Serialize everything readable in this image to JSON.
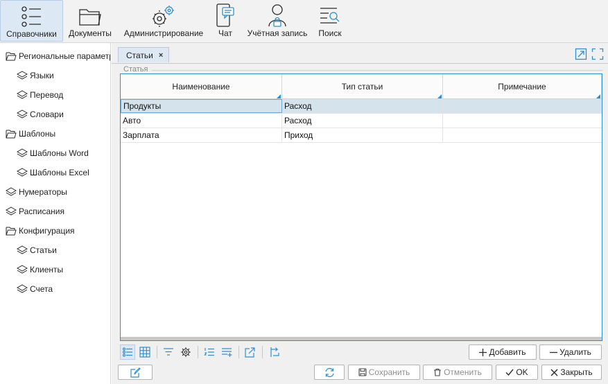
{
  "toolbar": {
    "items": [
      {
        "label": "Справочники",
        "icon": "list-bullets-icon",
        "active": true
      },
      {
        "label": "Документы",
        "icon": "folder-icon"
      },
      {
        "label": "Администрирование",
        "icon": "gears-icon"
      },
      {
        "label": "Чат",
        "icon": "chat-phone-icon"
      },
      {
        "label": "Учётная запись",
        "icon": "user-lock-icon"
      },
      {
        "label": "Поиск",
        "icon": "search-list-icon"
      }
    ]
  },
  "sidebar": {
    "items": [
      {
        "label": "Региональные параметры",
        "icon": "folder-open-icon",
        "level": 0
      },
      {
        "label": "Языки",
        "icon": "layers-icon",
        "level": 1
      },
      {
        "label": "Перевод",
        "icon": "layers-icon",
        "level": 1
      },
      {
        "label": "Словари",
        "icon": "layers-icon",
        "level": 1
      },
      {
        "label": "Шаблоны",
        "icon": "folder-open-icon",
        "level": 0
      },
      {
        "label": "Шаблоны Word",
        "icon": "layers-icon",
        "level": 1
      },
      {
        "label": "Шаблоны Excel",
        "icon": "layers-icon",
        "level": 1
      },
      {
        "label": "Нумераторы",
        "icon": "layers-icon",
        "level": 0
      },
      {
        "label": "Расписания",
        "icon": "layers-icon",
        "level": 0
      },
      {
        "label": "Конфигурация",
        "icon": "folder-open-icon",
        "level": 0
      },
      {
        "label": "Статьи",
        "icon": "layers-icon",
        "level": 1
      },
      {
        "label": "Клиенты",
        "icon": "layers-icon",
        "level": 1
      },
      {
        "label": "Счета",
        "icon": "layers-icon",
        "level": 1
      }
    ]
  },
  "tab": {
    "label": "Статьи",
    "close": "×"
  },
  "group": {
    "title": "Статья"
  },
  "grid": {
    "columns": [
      "Наименование",
      "Тип статьи",
      "Примечание"
    ],
    "rows": [
      [
        "Продукты",
        "Расход",
        ""
      ],
      [
        "Авто",
        "Расход",
        ""
      ],
      [
        "Зарплата",
        "Приход",
        ""
      ]
    ],
    "selected_row": 0
  },
  "buttons": {
    "add": "Добавить",
    "delete": "Удалить",
    "save": "Сохранить",
    "cancel": "Отменить",
    "ok": "OK",
    "close": "Закрыть"
  },
  "colors": {
    "accent": "#2f8fce",
    "toolbar_bg": "#f2f2f2",
    "selected_row": "#d5e4ec",
    "main_bg": "#f0f0f0"
  }
}
